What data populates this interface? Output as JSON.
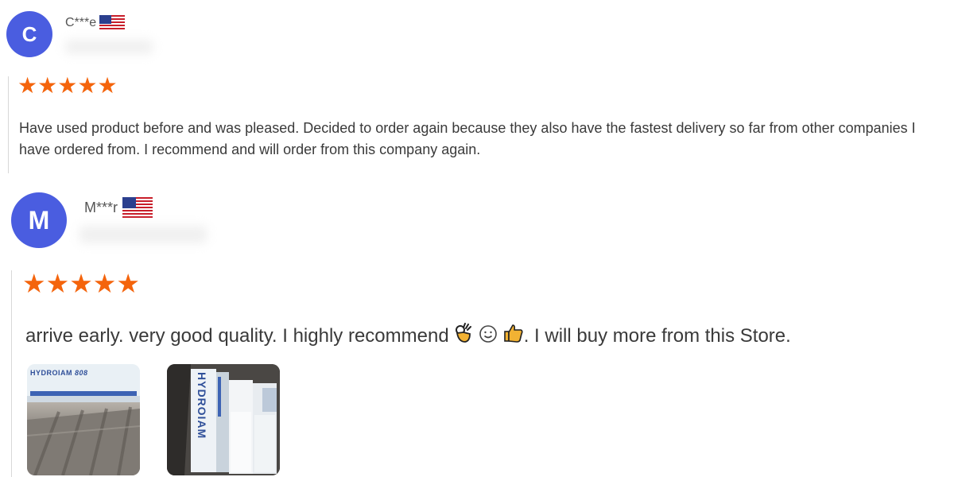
{
  "colors": {
    "avatar_bg": "#4a5de0",
    "star": "#f4640c",
    "text": "#3a3a3a"
  },
  "reviews": [
    {
      "avatar_letter": "C",
      "reviewer": "C***e",
      "country_flag": "us-flag-icon",
      "rating": 5,
      "text": "Have used product before and was pleased. Decided to order again because they also have the fastest delivery so far from other companies I have ordered from. I recommend and will order from this company again."
    },
    {
      "avatar_letter": "M",
      "reviewer": "M***r",
      "country_flag": "us-flag-icon",
      "rating": 5,
      "text_before_icons": "arrive early. very good quality. I highly recommend",
      "icons": [
        "ok-hand-icon",
        "smiley-icon",
        "thumbs-up-icon"
      ],
      "text_after_icons": ". I will buy more from this Store.",
      "photos": [
        {
          "caption": "HYDROIAM ",
          "caption_bold": "808"
        },
        {
          "caption": "HYDROIAM"
        }
      ]
    }
  ]
}
